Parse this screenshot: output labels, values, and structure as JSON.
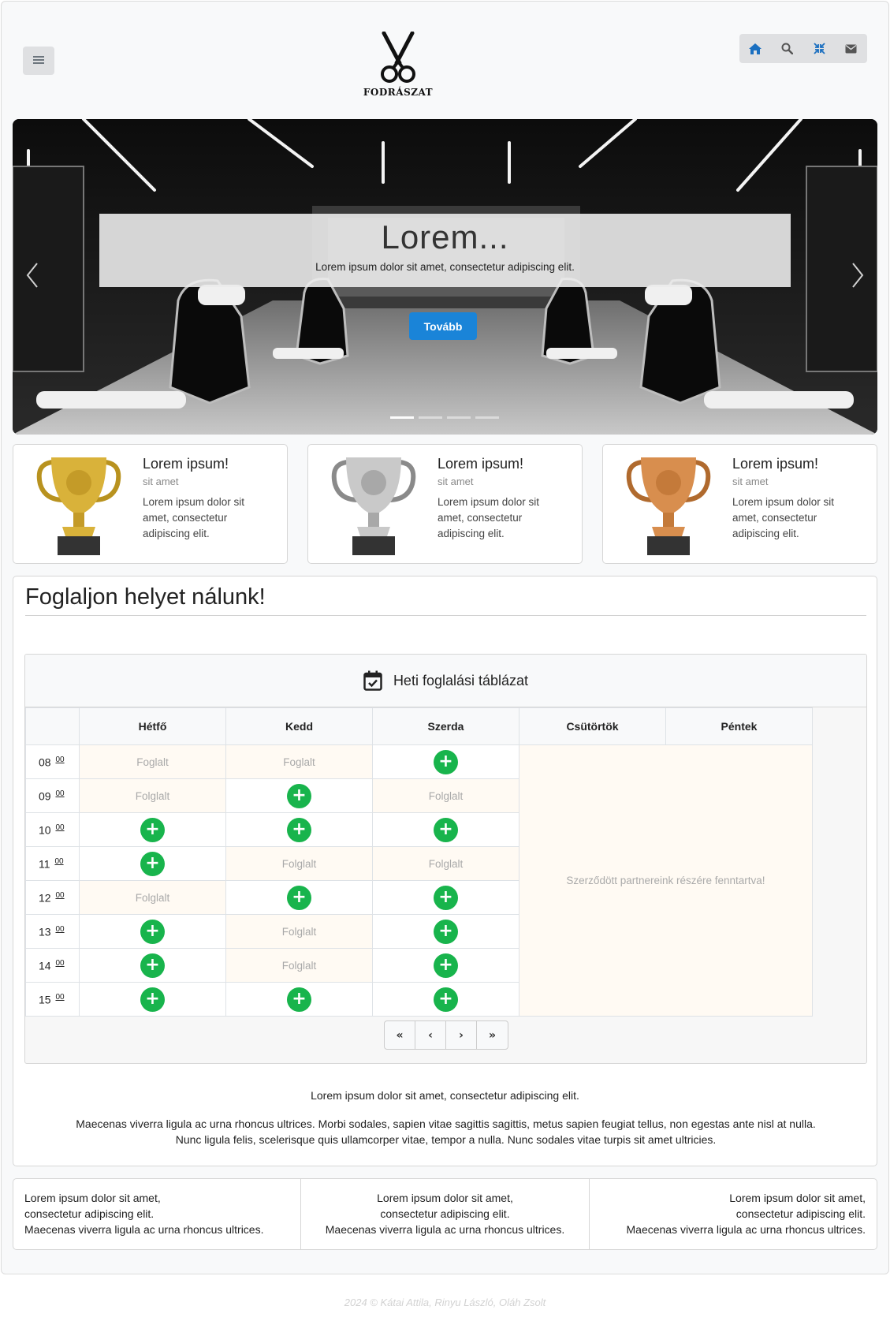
{
  "header": {
    "logo_text": "FODRÁSZAT",
    "menu_icon": "hamburger-icon",
    "nav_icons": [
      "home-icon",
      "search-icon",
      "compress-icon",
      "envelope-icon"
    ]
  },
  "carousel": {
    "title": "Lorem...",
    "text": "Lorem ipsum dolor sit amet, consectetur adipiscing elit.",
    "button": "Tovább",
    "slide_count": 4,
    "active_slide": 1
  },
  "cards": [
    {
      "title": "Lorem ipsum!",
      "subtitle": "sit amet",
      "body": "Lorem ipsum dolor sit amet, consectetur adipiscing elit.",
      "trophy": "gold"
    },
    {
      "title": "Lorem ipsum!",
      "subtitle": "sit amet",
      "body": "Lorem ipsum dolor sit amet, consectetur adipiscing elit.",
      "trophy": "silver"
    },
    {
      "title": "Lorem ipsum!",
      "subtitle": "sit amet",
      "body": "Lorem ipsum dolor sit amet, consectetur adipiscing elit.",
      "trophy": "bronze"
    }
  ],
  "booking": {
    "title": "Foglaljon helyet nálunk!",
    "table_title": "Heti foglalási táblázat",
    "days": [
      "Hétfő",
      "Kedd",
      "Szerda",
      "Csütörtök",
      "Péntek"
    ],
    "minute_suffix": "00",
    "reserved_text": "Szerződött partnereink részére fenntartva!",
    "busy_label_first": "Foglalt",
    "busy_label": "Folglalt",
    "rows": [
      {
        "hour": "08",
        "slots": [
          "busy_first",
          "busy_first",
          "free"
        ]
      },
      {
        "hour": "09",
        "slots": [
          "busy",
          "free",
          "busy"
        ]
      },
      {
        "hour": "10",
        "slots": [
          "free",
          "free",
          "free"
        ]
      },
      {
        "hour": "11",
        "slots": [
          "free",
          "busy",
          "busy"
        ]
      },
      {
        "hour": "12",
        "slots": [
          "busy",
          "free",
          "free"
        ]
      },
      {
        "hour": "13",
        "slots": [
          "free",
          "busy",
          "free"
        ]
      },
      {
        "hour": "14",
        "slots": [
          "free",
          "busy",
          "free"
        ]
      },
      {
        "hour": "15",
        "slots": [
          "free",
          "free",
          "free"
        ]
      }
    ],
    "pager": [
      "«",
      "‹",
      "›",
      "»"
    ],
    "text1": "Lorem ipsum dolor sit amet, consectetur adipiscing elit.",
    "text2a": "Maecenas viverra ligula ac urna rhoncus ultrices. Morbi sodales, sapien vitae sagittis sagittis, metus sapien feugiat tellus, non egestas ante nisl at nulla.",
    "text2b": "Nunc ligula felis, scelerisque quis ullamcorper vitae, tempor a nulla. Nunc sodales vitae turpis sit amet ultricies."
  },
  "footer": {
    "columns": [
      {
        "l1": "Lorem ipsum dolor sit amet,",
        "l2": "consectetur adipiscing elit.",
        "l3": "Maecenas viverra ligula ac urna rhoncus ultrices.",
        "align": "left"
      },
      {
        "l1": "Lorem ipsum dolor sit amet,",
        "l2": "consectetur adipiscing elit.",
        "l3": "Maecenas viverra ligula ac urna rhoncus ultrices.",
        "align": "center"
      },
      {
        "l1": "Lorem ipsum dolor sit amet,",
        "l2": "consectetur adipiscing elit.",
        "l3": "Maecenas viverra ligula ac urna rhoncus ultrices.",
        "align": "right"
      }
    ],
    "copyright": "2024 © Kátai Attila, Rinyu László, Oláh Zsolt"
  },
  "colors": {
    "accent": "#1a84d8",
    "free": "#18b44c",
    "busy_bg": "#fffaf3",
    "nav_icon": "#1a6fc0"
  }
}
